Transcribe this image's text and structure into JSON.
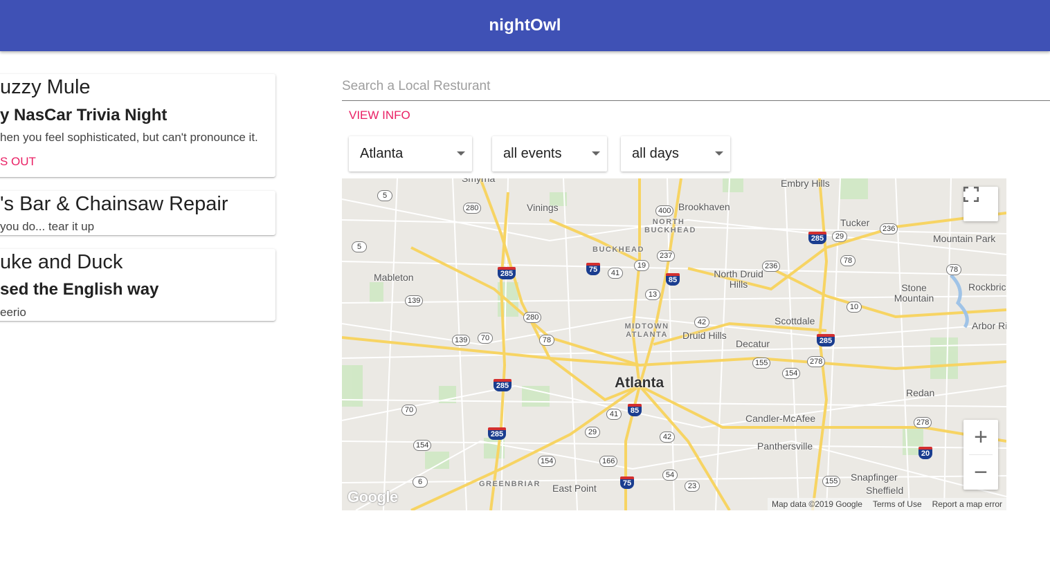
{
  "app": {
    "title": "nightOwl"
  },
  "cards": [
    {
      "title": "uzzy Mule",
      "subtitle": "y NasCar Trivia Night",
      "description": "hen you feel sophisticated, but can't pronounce it.",
      "action": "S OUT"
    },
    {
      "title": "'s Bar & Chainsaw Repair",
      "description": "you do... tear it up"
    },
    {
      "title": "uke and Duck",
      "subtitle": "sed the English way",
      "description": "eerio"
    }
  ],
  "search": {
    "placeholder": "Search a Local Resturant",
    "value": ""
  },
  "view_info": {
    "label": "VIEW INFO"
  },
  "filters": {
    "city": "Atlanta",
    "event_type": "all events",
    "days": "all days"
  },
  "map": {
    "center_label": "Atlanta",
    "places": [
      "Smyrna",
      "Embry Hills",
      "Vinings",
      "Brookhaven",
      "Tucker",
      "Mountain Park",
      "Mableton",
      "North Druid Hills",
      "Stone Mountain",
      "Rockbric",
      "Arbor Ri",
      "Scottdale",
      "Druid Hills",
      "Decatur",
      "Redan",
      "Candler-McAfee",
      "Panthersville",
      "Snapfinger",
      "Sheffield",
      "East Point"
    ],
    "districts": [
      "NORTH BUCKHEAD",
      "BUCKHEAD",
      "MIDTOWN ATLANTA",
      "GREENBRIAR"
    ],
    "routes": [
      "5",
      "280",
      "400",
      "236",
      "29",
      "5",
      "237",
      "19",
      "41",
      "78",
      "236",
      "78",
      "139",
      "13",
      "10",
      "280",
      "42",
      "139",
      "70",
      "78",
      "155",
      "278",
      "154",
      "70",
      "41",
      "29",
      "42",
      "278",
      "154",
      "154",
      "166",
      "6",
      "54",
      "155",
      "23"
    ],
    "interstates": [
      "285",
      "285",
      "75",
      "85",
      "285",
      "285",
      "285",
      "85",
      "20",
      "75"
    ],
    "attribution": {
      "data": "Map data ©2019 Google",
      "terms": "Terms of Use",
      "report": "Report a map error"
    },
    "logo": "Google",
    "zoom_in": "+",
    "zoom_out": "−"
  }
}
